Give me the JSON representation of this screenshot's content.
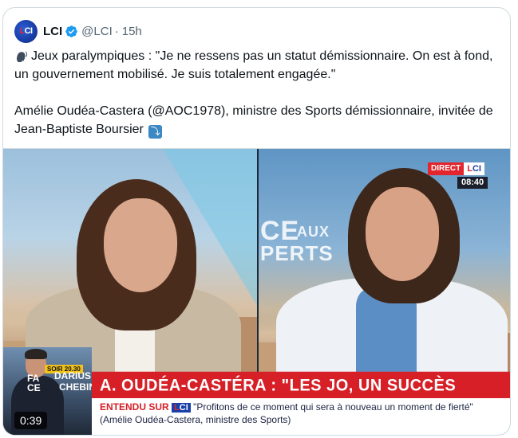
{
  "tweet": {
    "author_name": "LCI",
    "author_handle": "@LCI",
    "separator": "·",
    "time_ago": "15h",
    "avatar_text_l": "L",
    "avatar_text_ci": "CI",
    "line1": "Jeux paralympiques : \"Je ne ressens pas un statut démissionnaire. On est à fond, un gouvernement mobilisé. Je suis totalement engagée.\"",
    "line2": "Amélie Oudéa-Castera (@AOC1978), ministre des Sports démissionnaire, invitée de Jean-Baptiste Boursier",
    "arrow_emoji": "⤵"
  },
  "video": {
    "live_label": "DIRECT",
    "channel_l": "L",
    "channel_ci": "CI",
    "clock": "08:40",
    "deco_text_1": "CE",
    "deco_text_2": "AUX",
    "deco_text_3": "PERTS",
    "headline": "A. OUDÉA-CASTÉRA : \"LES JO, UN SUCCÈS COLLECTIF\"",
    "ticker_lead": "ENTENDU SUR",
    "ticker_quote": "\"Profitons de ce moment qui sera à nouveau un moment de fierté\" (Amélie Oudéa-Castera, ministre des Sports)",
    "inset_soir": "SOIR 20.30",
    "inset_faces": "FA",
    "inset_faces2": "CE",
    "inset_name1": "DARIUS",
    "inset_name2": "CHEBIN",
    "duration": "0:39"
  },
  "colors": {
    "verified": "#1d9bf0",
    "banner_red": "#d61f26",
    "lci_blue": "#1a3fa8"
  }
}
